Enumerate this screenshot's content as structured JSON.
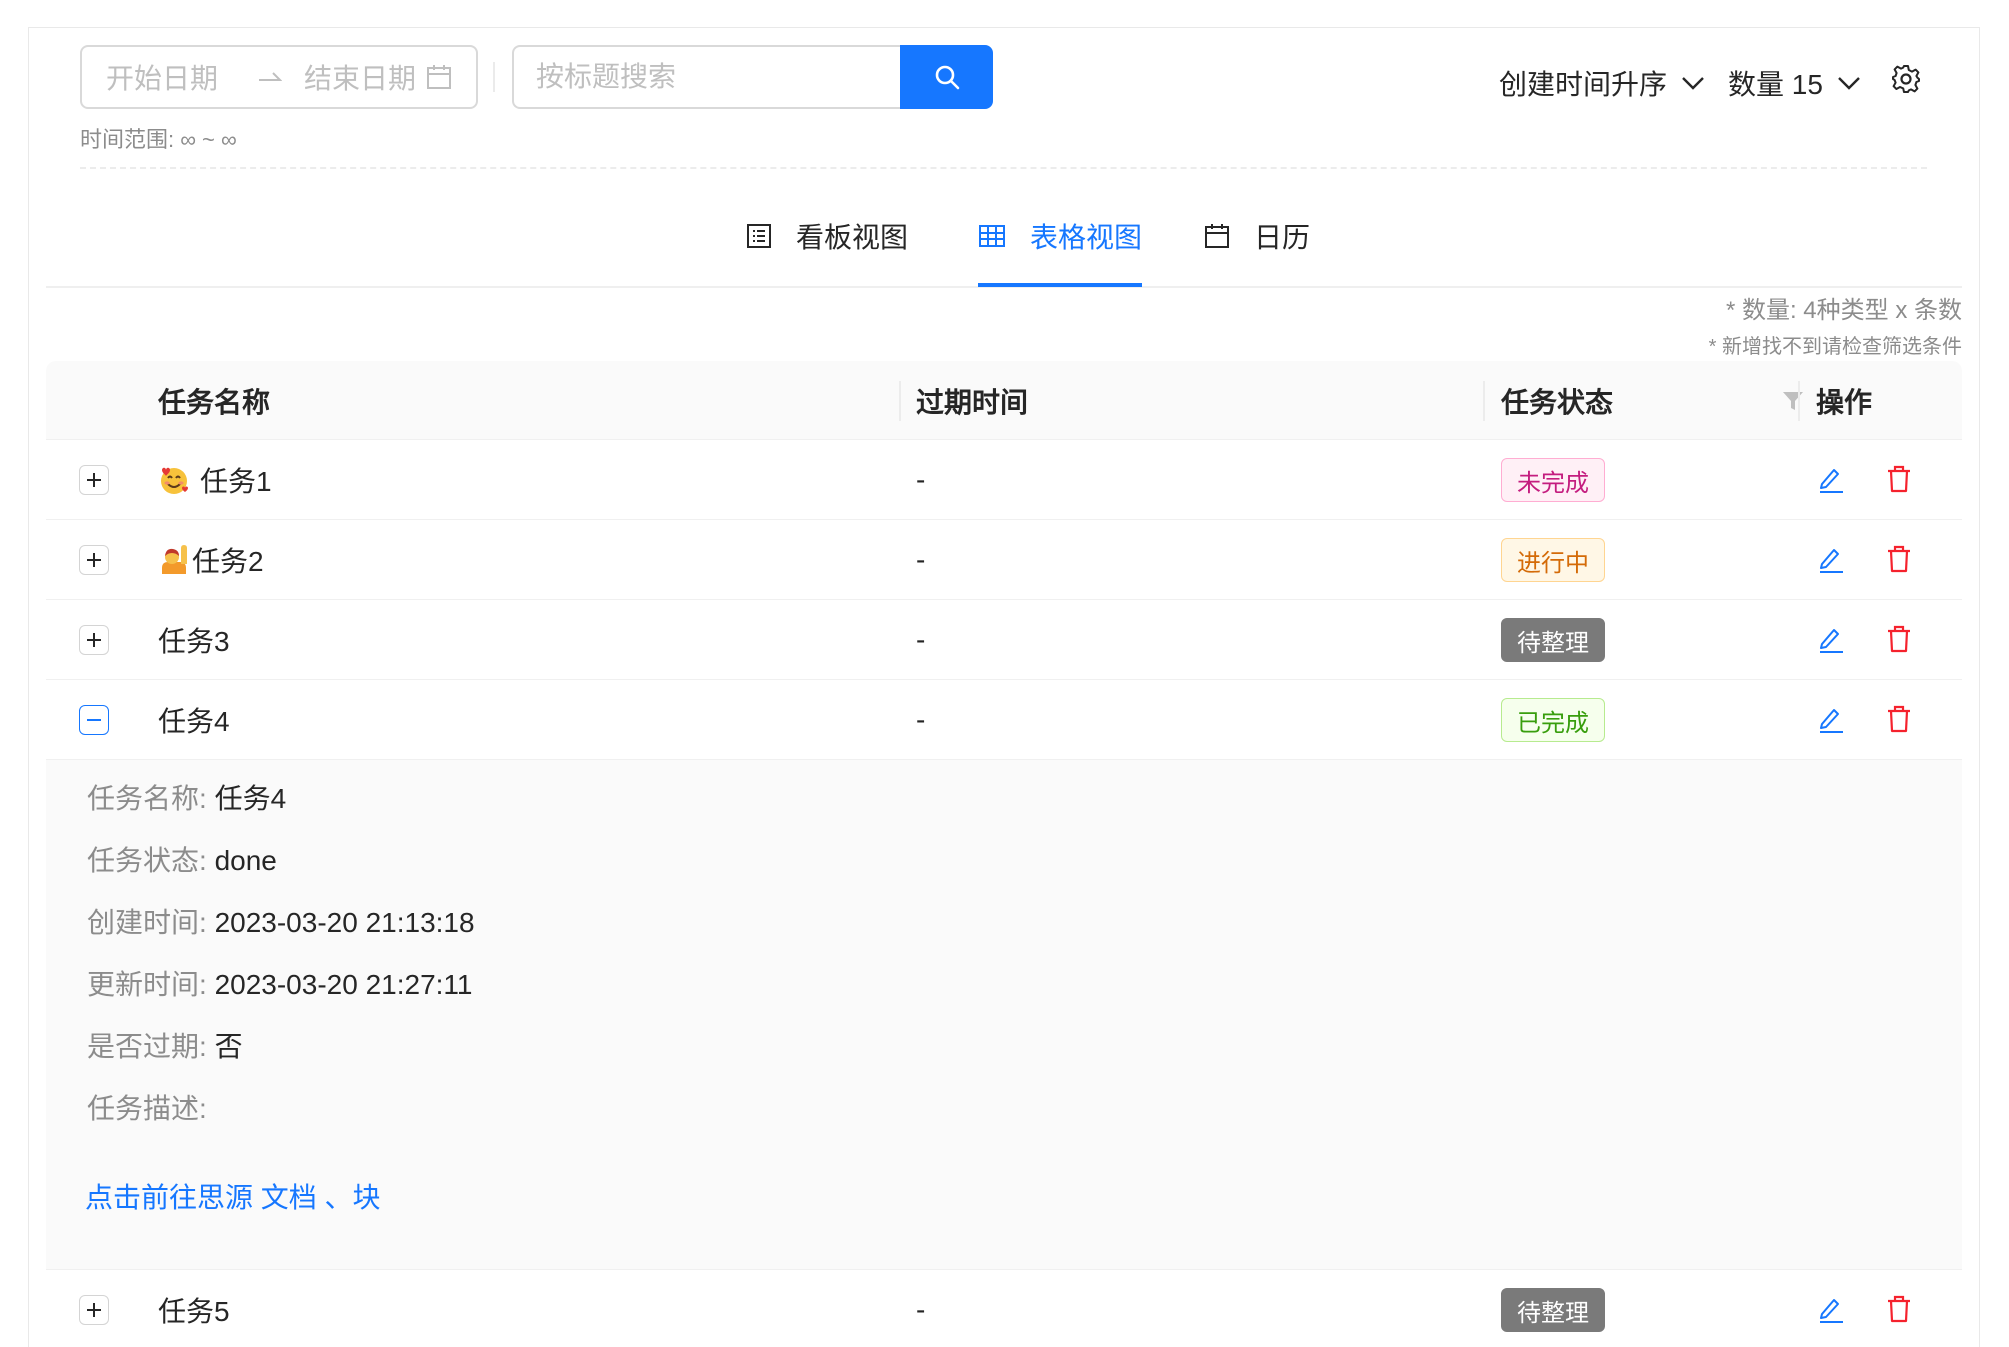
{
  "toolbar": {
    "start_placeholder": "开始日期",
    "end_placeholder": "结束日期",
    "search_placeholder": "按标题搜索",
    "time_range": "时间范围: ∞ ~ ∞",
    "sort_label": "创建时间升序",
    "count_label": "数量 15"
  },
  "tabs": [
    {
      "label": "看板视图",
      "icon": "kanban-icon"
    },
    {
      "label": "表格视图",
      "icon": "table-icon",
      "active": true
    },
    {
      "label": "日历",
      "icon": "calendar-icon"
    }
  ],
  "hints": {
    "count_hint": "* 数量: 4种类型 x 条数",
    "filter_hint": "* 新增找不到请检查筛选条件"
  },
  "table": {
    "columns": [
      "任务名称",
      "过期时间",
      "任务状态",
      "操作"
    ],
    "rows": [
      {
        "name": "任务1",
        "emoji": "smiling-face-with-hearts",
        "expire": "-",
        "status": "未完成",
        "status_kind": "todo",
        "expanded": false
      },
      {
        "name": "任务2",
        "emoji": "person-raising-hand",
        "expire": "-",
        "status": "进行中",
        "status_kind": "doing",
        "expanded": false
      },
      {
        "name": "任务3",
        "expire": "-",
        "status": "待整理",
        "status_kind": "pending",
        "expanded": false
      },
      {
        "name": "任务4",
        "expire": "-",
        "status": "已完成",
        "status_kind": "done",
        "expanded": true
      },
      {
        "name": "任务5",
        "expire": "-",
        "status": "待整理",
        "status_kind": "pending",
        "expanded": false
      }
    ]
  },
  "detail": {
    "name_key": "任务名称:",
    "name_val": "任务4",
    "status_key": "任务状态:",
    "status_val": "done",
    "created_key": "创建时间:",
    "created_val": "2023-03-20 21:13:18",
    "updated_key": "更新时间:",
    "updated_val": "2023-03-20 21:27:11",
    "expired_key": "是否过期:",
    "expired_val": "否",
    "desc_key": "任务描述:",
    "link_text": "点击前往思源 文档 、块"
  },
  "colors": {
    "primary": "#1677ff",
    "danger": "#f5222d",
    "todo": "#c41d7f",
    "doing": "#d46b08",
    "pending": "#7a7a7a",
    "done": "#389e0d"
  }
}
